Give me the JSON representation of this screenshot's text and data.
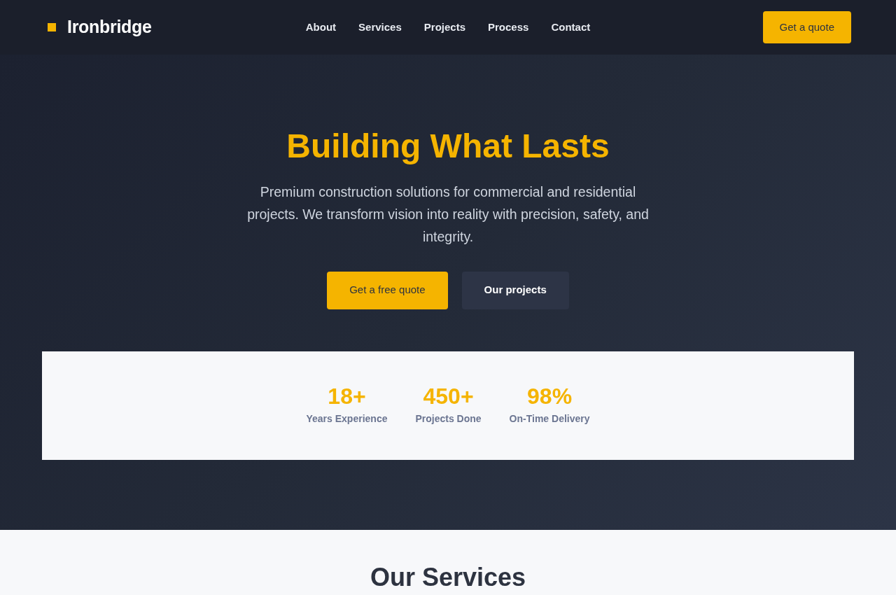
{
  "navbar": {
    "logo": "Ironbridge",
    "links": [
      "About",
      "Services",
      "Projects",
      "Process",
      "Contact"
    ],
    "cta": "Get a quote"
  },
  "hero": {
    "title": "Building What Lasts",
    "subtitle": "Premium construction solutions for commercial and residential projects. We transform vision into reality with precision, safety, and integrity.",
    "buttons": [
      {
        "label": "Get a free quote",
        "kind": "primary"
      },
      {
        "label": "Our projects",
        "kind": "secondary"
      }
    ]
  },
  "stats": [
    {
      "value": "18+",
      "label": "Years Experience"
    },
    {
      "value": "450+",
      "label": "Projects Done"
    },
    {
      "value": "98%",
      "label": "On-Time Delivery"
    }
  ],
  "services": {
    "heading": "Our Services"
  }
}
